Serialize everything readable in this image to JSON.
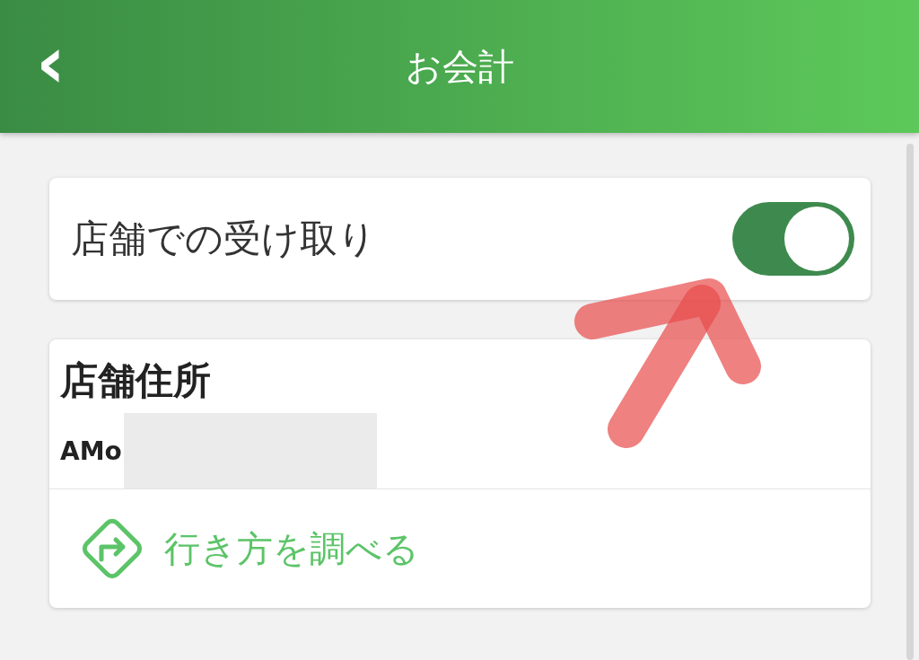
{
  "header": {
    "title": "お会計",
    "back_icon": "‹"
  },
  "pickup": {
    "label": "店舗での受け取り",
    "on": true
  },
  "store": {
    "heading": "店舗住所",
    "address": "AMo",
    "redacted": true
  },
  "directions_link": {
    "label": "行き方を調べる"
  },
  "annotation": {
    "kind": "arrow"
  }
}
